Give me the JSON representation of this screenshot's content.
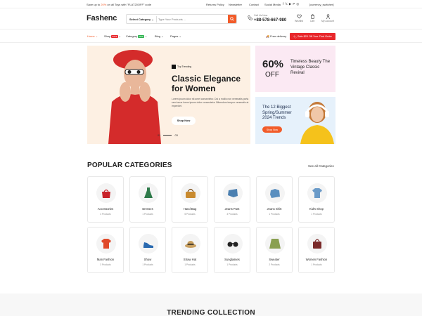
{
  "topbar": {
    "promo_prefix": "Save up to",
    "promo_discount": "20%",
    "promo_suffix": "on all Toys with \"FLAT20OFF\" code",
    "links": [
      "Returns Policy",
      "Newsletter",
      "Contact",
      "Social Media"
    ],
    "currency_switcher": "[currency_switcher]"
  },
  "header": {
    "logo": "Fashenc",
    "search": {
      "category": "Select Category",
      "placeholder": "Type Your Products ..."
    },
    "phone_label": "Call Us Now",
    "phone_number": "+88-578-667-980",
    "icons": [
      {
        "label": "Wishlist",
        "icon": "heart-icon"
      },
      {
        "label": "Cart",
        "icon": "cart-icon"
      },
      {
        "label": "My Account",
        "icon": "user-icon"
      }
    ]
  },
  "nav": {
    "items": [
      {
        "label": "Home",
        "badge": "",
        "active": true
      },
      {
        "label": "Shop",
        "badge": "SALE",
        "badge_color": "#e8272c"
      },
      {
        "label": "Category",
        "badge": "NEW",
        "badge_color": "#2bb24c"
      },
      {
        "label": "Blog",
        "badge": ""
      },
      {
        "label": "Pages",
        "badge": ""
      }
    ],
    "free_delivery": "Free delivery",
    "first_order": "Sale $20 Off Your First Order"
  },
  "hero": {
    "tag": "Top Trending",
    "title": "Classic Elegance for Women",
    "description": "Lorem ipsum dolor sit amet consectetur. Dui a mollis non venenatis porta sem lacus lorem ipsum dolor consectetur. Bibendum tempor venenatis at imperdiet.",
    "button": "Shop Now",
    "slide_current": "01",
    "slide_last": "03"
  },
  "promo_discount": {
    "percent": "60%",
    "off": "OFF",
    "text": "Timeless Beauty The Vintage Classic Revival"
  },
  "promo_trends": {
    "text": "The 12 Biggest Spring/Summer 2024 Trends",
    "button": "Shop Now"
  },
  "categories": {
    "title": "POPULAR CATEGORIES",
    "see_all": "See all Categories",
    "items": [
      {
        "name": "Accessories",
        "count": "4 Products",
        "icon": "bag-icon",
        "color": "#c8232a"
      },
      {
        "name": "Dresses",
        "count": "1 Products",
        "icon": "dress-icon",
        "color": "#2e7a4a"
      },
      {
        "name": "Hand Bag",
        "count": "5 Products",
        "icon": "handbag-icon",
        "color": "#c98a2e"
      },
      {
        "name": "Jeans Pant",
        "count": "3 Products",
        "icon": "jeans-icon",
        "color": "#4a7fb0"
      },
      {
        "name": "Jeans Shirt",
        "count": "1 Products",
        "icon": "shirt-icon",
        "color": "#5a8fbf"
      },
      {
        "name": "Kid's Shop",
        "count": "1 Products",
        "icon": "kids-shirt-icon",
        "color": "#6a9ac8"
      },
      {
        "name": "Man Fashion",
        "count": "3 Products",
        "icon": "tshirt-icon",
        "color": "#e04a2a"
      },
      {
        "name": "Show",
        "count": "1 Products",
        "icon": "shoe-icon",
        "color": "#2a6ab0"
      },
      {
        "name": "Straw Hat",
        "count": "1 Products",
        "icon": "hat-icon",
        "color": "#c9a060"
      },
      {
        "name": "Sunglasses",
        "count": "1 Products",
        "icon": "sunglasses-icon",
        "color": "#222222"
      },
      {
        "name": "Sweater",
        "count": "2 Products",
        "icon": "sweater-icon",
        "color": "#8aa050"
      },
      {
        "name": "Women Fashion",
        "count": "1 Products",
        "icon": "women-bag-icon",
        "color": "#7a2a2a"
      }
    ]
  },
  "trending": {
    "title": "TRENDING COLLECTION"
  },
  "colors": {
    "accent": "#f25c2a",
    "red": "#e8272c"
  }
}
